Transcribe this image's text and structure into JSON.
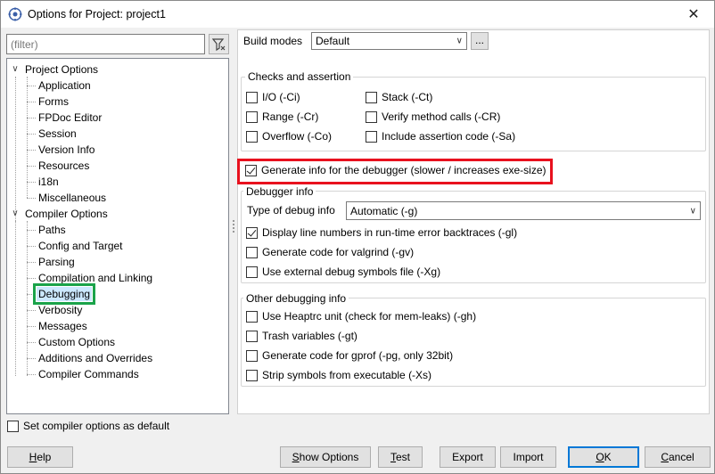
{
  "window": {
    "title": "Options for Project: project1",
    "close_glyph": "✕"
  },
  "filter": {
    "placeholder": "(filter)"
  },
  "tree": {
    "groups": [
      {
        "label": "Project Options",
        "items": [
          "Application",
          "Forms",
          "FPDoc Editor",
          "Session",
          "Version Info",
          "Resources",
          "i18n",
          "Miscellaneous"
        ]
      },
      {
        "label": "Compiler Options",
        "items": [
          "Paths",
          "Config and Target",
          "Parsing",
          "Compilation and Linking",
          "Debugging",
          "Verbosity",
          "Messages",
          "Custom Options",
          "Additions and Overrides",
          "Compiler Commands"
        ]
      }
    ],
    "selected": "Debugging"
  },
  "set_default": {
    "label": "Set compiler options as default",
    "checked": false
  },
  "build_modes": {
    "label": "Build modes",
    "value": "Default",
    "dots_label": "..."
  },
  "checks": {
    "title": "Checks and assertion",
    "items": [
      {
        "label": "I/O (-Ci)",
        "checked": false
      },
      {
        "label": "Stack (-Ct)",
        "checked": false
      },
      {
        "label": "Range (-Cr)",
        "checked": false
      },
      {
        "label": "Verify method calls (-CR)",
        "checked": false
      },
      {
        "label": "Overflow (-Co)",
        "checked": false
      },
      {
        "label": "Include assertion code (-Sa)",
        "checked": false
      }
    ]
  },
  "generate_debug": {
    "label": "Generate info for the debugger (slower / increases exe-size)",
    "checked": true
  },
  "debugger_info": {
    "title": "Debugger info",
    "type_label": "Type of debug info",
    "type_value": "Automatic (-g)",
    "items": [
      {
        "label": "Display line numbers in run-time error backtraces (-gl)",
        "checked": true
      },
      {
        "label": "Generate code for valgrind (-gv)",
        "checked": false
      },
      {
        "label": "Use external debug symbols file (-Xg)",
        "checked": false
      }
    ]
  },
  "other_debug": {
    "title": "Other debugging info",
    "items": [
      {
        "label": "Use Heaptrc unit (check for mem-leaks) (-gh)",
        "checked": false
      },
      {
        "label": "Trash variables (-gt)",
        "checked": false
      },
      {
        "label": "Generate code for gprof (-pg, only 32bit)",
        "checked": false
      },
      {
        "label": "Strip symbols from executable (-Xs)",
        "checked": false
      }
    ]
  },
  "buttons": {
    "help": "Help",
    "show_options": "Show Options",
    "test": "Test",
    "export": "Export",
    "import": "Import",
    "ok": "OK",
    "cancel": "Cancel"
  },
  "colors": {
    "highlight_red": "#e8111e",
    "highlight_green": "#1aa34a",
    "selection": "#cce8ff"
  }
}
